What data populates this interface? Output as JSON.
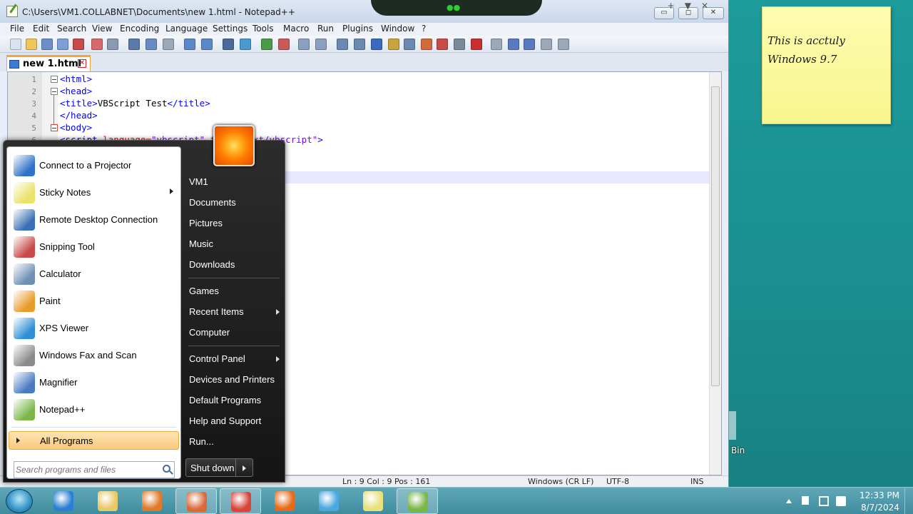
{
  "window": {
    "title": "C:\\Users\\VM1.COLLABNET\\Documents\\new 1.html - Notepad++",
    "min_label": "▭",
    "max_label": "◻",
    "close_label": "✕"
  },
  "menu": {
    "items": [
      "File",
      "Edit",
      "Search",
      "View",
      "Encoding",
      "Language",
      "Settings",
      "Tools",
      "Macro",
      "Run",
      "Plugins",
      "Window",
      "?"
    ],
    "right_controls": "+▼✕"
  },
  "tab": {
    "label": "new 1.html",
    "close": "✕"
  },
  "editor": {
    "line_numbers": [
      "1",
      "2",
      "3",
      "4",
      "5",
      "6"
    ],
    "lines": [
      {
        "tag1": "<html>"
      },
      {
        "tag1": "<head>"
      },
      {
        "tag1": "<title>",
        "text": "VBScript Test",
        "tag2": "</title>"
      },
      {
        "tag1": "</head>"
      },
      {
        "tag1": "<body>"
      },
      {
        "tag1": "<script ",
        "attr": "language=",
        "val": "\"vbscript\"",
        "attr2": " type=",
        "val2": "\"text/vbscript\"",
        "tag2": ">"
      }
    ]
  },
  "status": {
    "pos": "Ln : 9   Col : 9   Pos : 161",
    "eol": "Windows (CR LF)",
    "enc": "UTF-8",
    "mode": "INS"
  },
  "sticky": {
    "text": "This is acctuly\nWindows 9.7"
  },
  "desktop": {
    "recycle_label": "Bin"
  },
  "start_menu": {
    "programs": [
      {
        "label": "Connect to a Projector",
        "icon": "projector-icon",
        "color": "#2f73c8",
        "arrow": false
      },
      {
        "label": "Sticky Notes",
        "icon": "sticky-notes-icon",
        "color": "#e9e36a",
        "arrow": true
      },
      {
        "label": "Remote Desktop Connection",
        "icon": "remote-desktop-icon",
        "color": "#3a6fb5",
        "arrow": false
      },
      {
        "label": "Snipping Tool",
        "icon": "scissors-icon",
        "color": "#c94a4a",
        "arrow": false
      },
      {
        "label": "Calculator",
        "icon": "calculator-icon",
        "color": "#6f8fb5",
        "arrow": false
      },
      {
        "label": "Paint",
        "icon": "paint-icon",
        "color": "#e89a2a",
        "arrow": false
      },
      {
        "label": "XPS Viewer",
        "icon": "xps-viewer-icon",
        "color": "#2f8fd6",
        "arrow": false
      },
      {
        "label": "Windows Fax and Scan",
        "icon": "fax-icon",
        "color": "#8a8a8a",
        "arrow": false
      },
      {
        "label": "Magnifier",
        "icon": "magnifier-icon",
        "color": "#4a7ac0",
        "arrow": false
      },
      {
        "label": "Notepad++",
        "icon": "notepadpp-icon",
        "color": "#7ab648",
        "arrow": false
      }
    ],
    "all_programs": "All Programs",
    "search_placeholder": "Search programs and files",
    "places": [
      {
        "label": "VM1",
        "arrow": false,
        "sep_after": false
      },
      {
        "label": "Documents",
        "arrow": false,
        "sep_after": false
      },
      {
        "label": "Pictures",
        "arrow": false,
        "sep_after": false
      },
      {
        "label": "Music",
        "arrow": false,
        "sep_after": false
      },
      {
        "label": "Downloads",
        "arrow": false,
        "sep_after": true
      },
      {
        "label": "Games",
        "arrow": false,
        "sep_after": false
      },
      {
        "label": "Recent Items",
        "arrow": true,
        "sep_after": false
      },
      {
        "label": "Computer",
        "arrow": false,
        "sep_after": true
      },
      {
        "label": "Control Panel",
        "arrow": true,
        "sep_after": false
      },
      {
        "label": "Devices and Printers",
        "arrow": false,
        "sep_after": false
      },
      {
        "label": "Default Programs",
        "arrow": false,
        "sep_after": false
      },
      {
        "label": "Help and Support",
        "arrow": false,
        "sep_after": false
      },
      {
        "label": "Run...",
        "arrow": false,
        "sep_after": false
      }
    ],
    "shutdown": "Shut down"
  },
  "taskbar": {
    "apps": [
      {
        "name": "internet-explorer-icon",
        "color": "#2a7fd4",
        "open": false
      },
      {
        "name": "file-explorer-icon",
        "color": "#e9c866",
        "open": false
      },
      {
        "name": "media-player-icon",
        "color": "#e07a2a",
        "open": false
      },
      {
        "name": "app-icon",
        "color": "#d86a3a",
        "open": true
      },
      {
        "name": "chrome-icon",
        "color": "#d8443a",
        "open": true
      },
      {
        "name": "firefox-icon",
        "color": "#e66a1a",
        "open": false
      },
      {
        "name": "network-icon",
        "color": "#4aa8e0",
        "open": false
      },
      {
        "name": "sticky-notes-icon",
        "color": "#e8e07a",
        "open": false
      },
      {
        "name": "notepadpp-icon",
        "color": "#7ab648",
        "open": true
      }
    ],
    "clock_time": "12:33 PM",
    "clock_date": "8/7/2024"
  }
}
